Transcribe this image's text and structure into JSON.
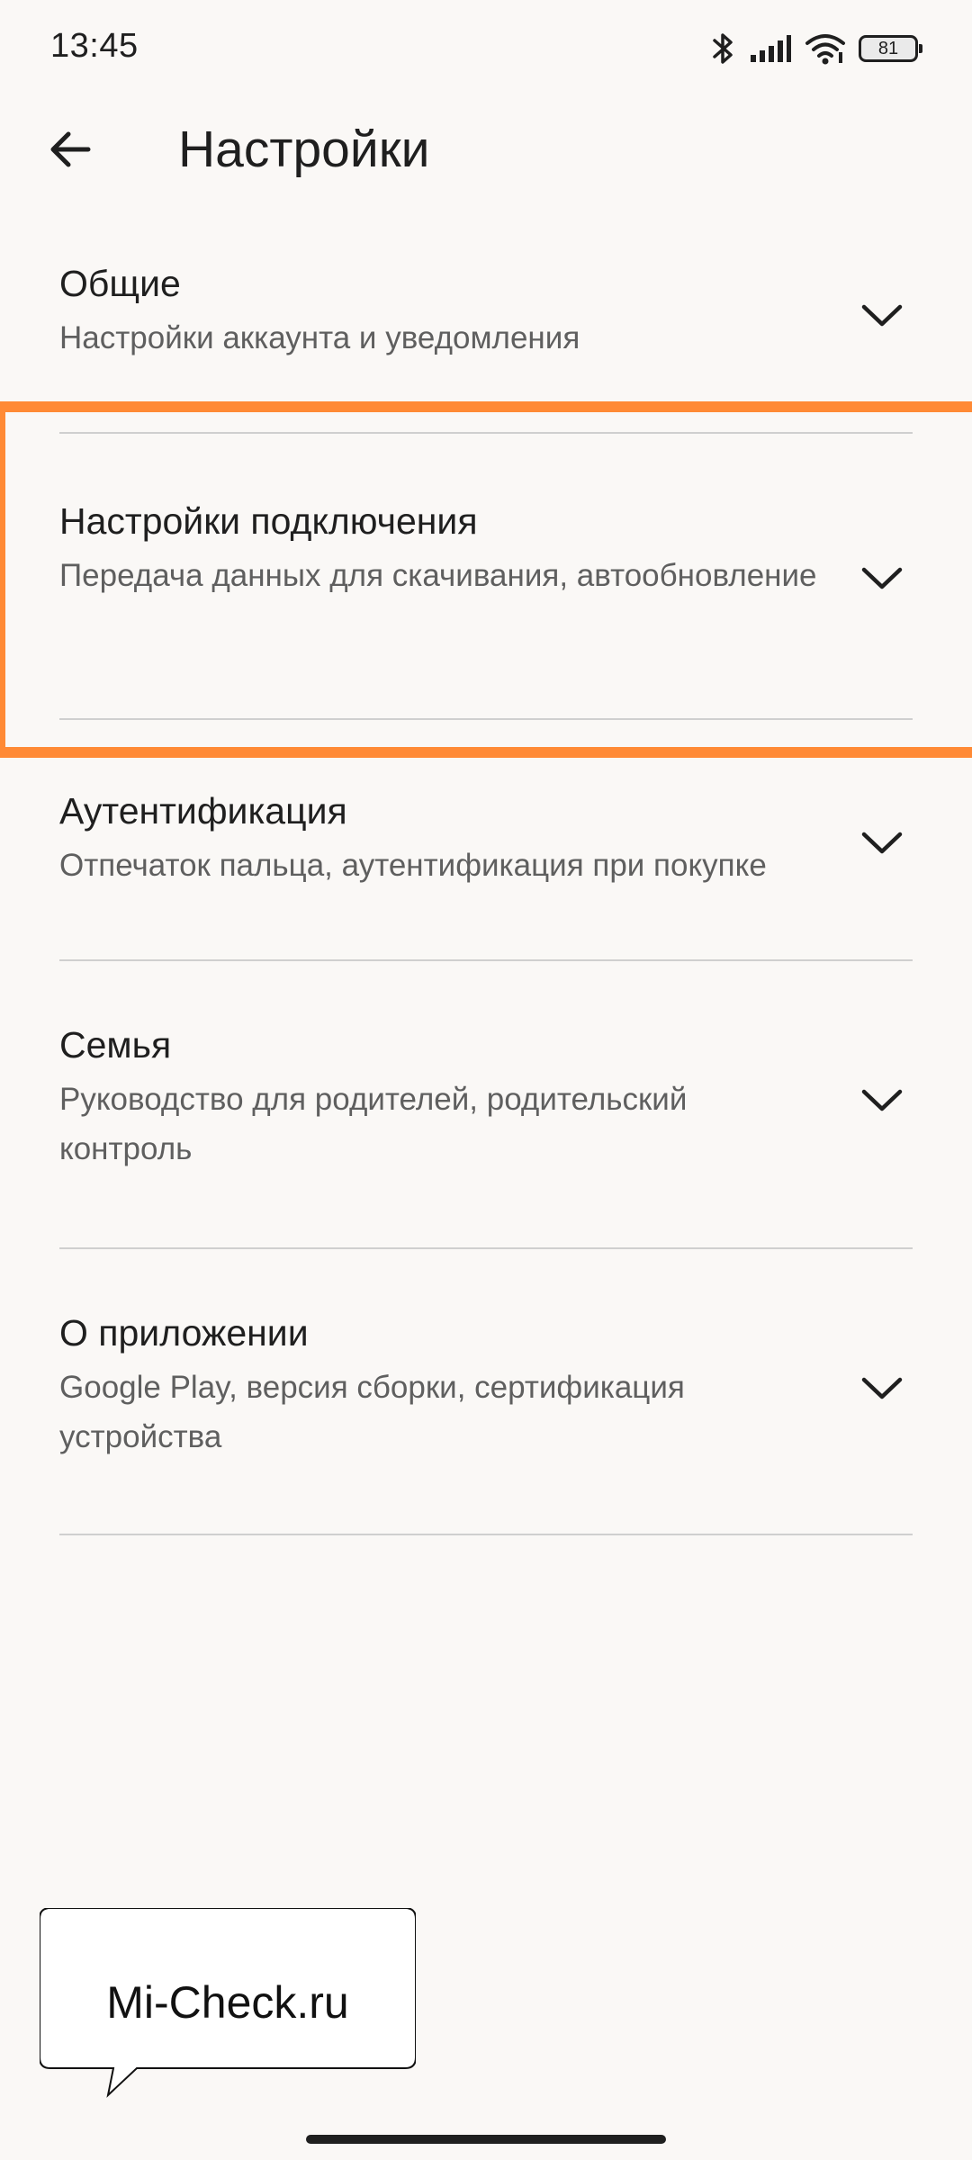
{
  "status_bar": {
    "time": "13:45",
    "battery_level": "81",
    "icons": [
      "bluetooth-icon",
      "signal-icon",
      "wifi-icon",
      "battery-icon"
    ]
  },
  "app_bar": {
    "back_icon": "arrow-back-icon",
    "title": "Настройки"
  },
  "settings": {
    "items": [
      {
        "title": "Общие",
        "subtitle": "Настройки аккаунта и уведомления",
        "icon": "chevron-down-icon"
      },
      {
        "title": "Настройки подключения",
        "subtitle": "Передача данных для скачивания, автообновление",
        "icon": "chevron-down-icon",
        "highlighted": true
      },
      {
        "title": "Аутентификация",
        "subtitle": "Отпечаток пальца, аутентификация при покупке",
        "icon": "chevron-down-icon"
      },
      {
        "title": "Семья",
        "subtitle": "Руководство для родителей, родительский контроль",
        "icon": "chevron-down-icon"
      },
      {
        "title": "О приложении",
        "subtitle": "Google Play, версия сборки, сертификация устройства",
        "icon": "chevron-down-icon"
      }
    ]
  },
  "watermark": {
    "text": "Mi-Check.ru"
  },
  "colors": {
    "background": "#faf8f6",
    "text_primary": "#1f1f1f",
    "text_secondary": "#5f5f5f",
    "divider": "#cfcfcf",
    "highlight": "#ff8a35"
  }
}
